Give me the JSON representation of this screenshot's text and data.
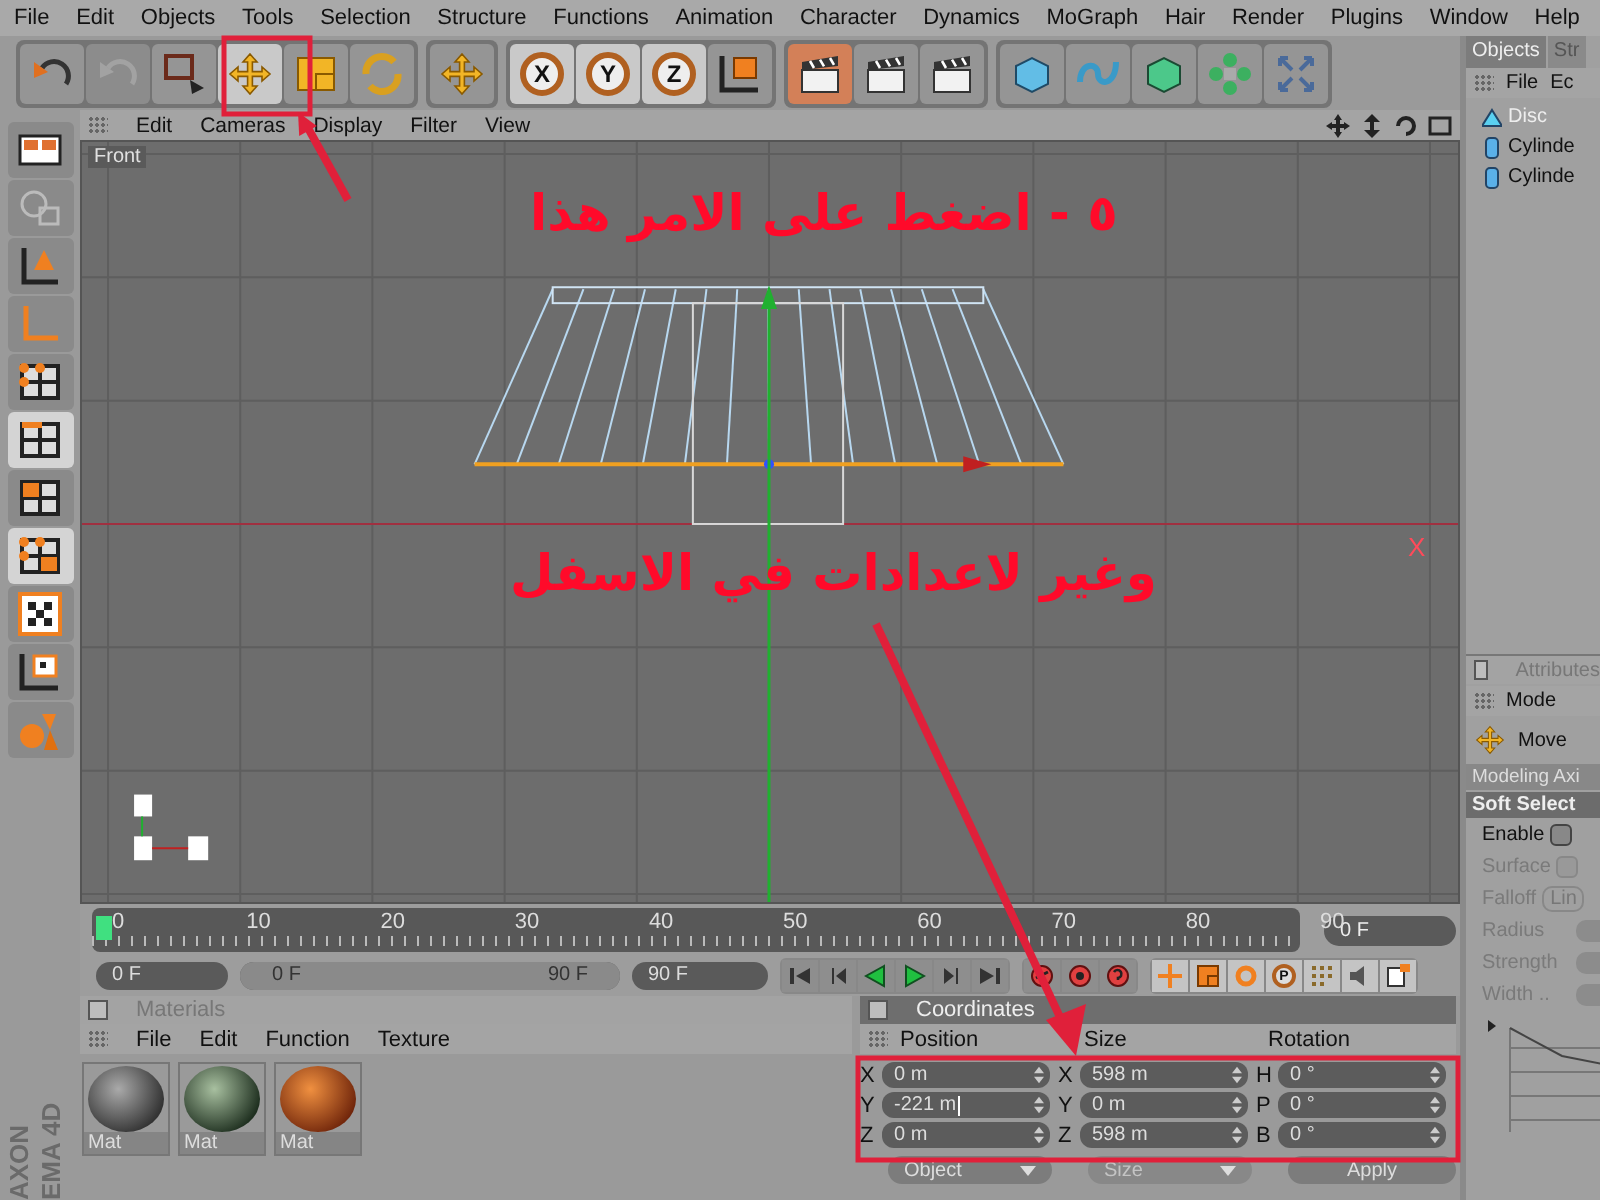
{
  "menu": [
    "File",
    "Edit",
    "Objects",
    "Tools",
    "Selection",
    "Structure",
    "Functions",
    "Animation",
    "Character",
    "Dynamics",
    "MoGraph",
    "Hair",
    "Render",
    "Plugins",
    "Window",
    "Help"
  ],
  "toolbar": {
    "groups": [
      [
        {
          "kind": "undo",
          "selected": false,
          "disabled": false
        },
        {
          "kind": "redo",
          "selected": false,
          "disabled": true
        },
        {
          "kind": "rect-select",
          "selected": false,
          "disabled": false
        },
        {
          "kind": "move",
          "selected": true,
          "disabled": false
        },
        {
          "kind": "scale",
          "selected": false,
          "disabled": false
        },
        {
          "kind": "rotate",
          "selected": false,
          "disabled": false
        }
      ],
      [
        {
          "kind": "move-menu",
          "selected": false,
          "disabled": false
        }
      ],
      [
        {
          "kind": "axis",
          "label": "X",
          "selected": true,
          "disabled": false
        },
        {
          "kind": "axis",
          "label": "Y",
          "selected": true,
          "disabled": false
        },
        {
          "kind": "axis",
          "label": "Z",
          "selected": true,
          "disabled": false
        },
        {
          "kind": "coord",
          "selected": false,
          "disabled": false
        }
      ],
      [
        {
          "kind": "render-view",
          "selected": true,
          "disabled": false
        },
        {
          "kind": "render-picture",
          "selected": false,
          "disabled": false
        },
        {
          "kind": "render-settings",
          "selected": false,
          "disabled": false
        }
      ],
      [
        {
          "kind": "cube",
          "selected": false,
          "disabled": false
        },
        {
          "kind": "spline",
          "selected": false,
          "disabled": false
        },
        {
          "kind": "nurbs",
          "selected": false,
          "disabled": false
        },
        {
          "kind": "array",
          "selected": false,
          "disabled": false
        },
        {
          "kind": "deformer",
          "selected": false,
          "disabled": false
        }
      ]
    ]
  },
  "mode_tools": [
    {
      "kind": "layout",
      "selected": false
    },
    {
      "kind": "faded",
      "selected": false
    },
    {
      "kind": "model",
      "selected": false
    },
    {
      "kind": "object-axis",
      "selected": false
    },
    {
      "kind": "points",
      "selected": false
    },
    {
      "kind": "edges",
      "selected": true
    },
    {
      "kind": "polygons",
      "selected": false
    },
    {
      "kind": "uv-polygons",
      "selected": true
    },
    {
      "kind": "texture",
      "selected": false
    },
    {
      "kind": "texture-axis",
      "selected": false
    },
    {
      "kind": "sculpt",
      "selected": false
    }
  ],
  "logo": [
    "AXON",
    "EMA 4D"
  ],
  "viewport": {
    "menu": [
      "Edit",
      "Cameras",
      "Display",
      "Filter",
      "View"
    ],
    "nav_icons": [
      {
        "kind": "move"
      },
      {
        "kind": "dolly"
      },
      {
        "kind": "rotate"
      },
      {
        "kind": "maximize"
      }
    ],
    "camera_label": "Front",
    "axis_label": "X"
  },
  "timeline": {
    "ticks": [
      "0",
      "10",
      "20",
      "30",
      "40",
      "50",
      "60",
      "70",
      "80",
      "90"
    ],
    "level": 0,
    "frame_field": "0 F"
  },
  "controls": {
    "start": "0 F",
    "range": {
      "start": "0 F",
      "end": "90 F",
      "level": 1
    },
    "end": "90 F",
    "playback": [
      {
        "kind": "first"
      },
      {
        "kind": "prev-key"
      },
      {
        "kind": "play-back"
      },
      {
        "kind": "play"
      },
      {
        "kind": "next-key"
      },
      {
        "kind": "last"
      }
    ],
    "record": [
      {
        "kind": "record"
      },
      {
        "kind": "autokey"
      },
      {
        "kind": "help"
      }
    ],
    "keys": [
      {
        "kind": "position"
      },
      {
        "kind": "scale"
      },
      {
        "kind": "rotation"
      },
      {
        "kind": "parameter",
        "label": "P"
      },
      {
        "kind": "points"
      },
      {
        "kind": "sound"
      },
      {
        "kind": "more"
      }
    ]
  },
  "materials": {
    "title": "Materials",
    "checked": false,
    "menu": [
      "File",
      "Edit",
      "Function",
      "Texture"
    ],
    "items": [
      {
        "name": "Mat",
        "kind": "noise"
      },
      {
        "name": "Mat",
        "kind": "plaid"
      },
      {
        "name": "Mat",
        "kind": "wood"
      }
    ]
  },
  "coordinates": {
    "title": "Coordinates",
    "checked": false,
    "columns": [
      {
        "header": "Position",
        "fields": [
          {
            "axis": "X",
            "value": "0 m",
            "editing": false
          },
          {
            "axis": "Y",
            "value": "-221 m",
            "editing": true
          },
          {
            "axis": "Z",
            "value": "0 m",
            "editing": false
          }
        ]
      },
      {
        "header": "Size",
        "fields": [
          {
            "axis": "X",
            "value": "598 m",
            "editing": false
          },
          {
            "axis": "Y",
            "value": "0 m",
            "editing": false
          },
          {
            "axis": "Z",
            "value": "598 m",
            "editing": false
          }
        ]
      },
      {
        "header": "Rotation",
        "fields": [
          {
            "axis": "H",
            "value": "0 °",
            "editing": false
          },
          {
            "axis": "P",
            "value": "0 °",
            "editing": false
          },
          {
            "axis": "B",
            "value": "0 °",
            "editing": false
          }
        ]
      }
    ],
    "buttons": [
      {
        "kind": "dropdown",
        "label": "Object",
        "disabled": false
      },
      {
        "kind": "dropdown",
        "label": "Size",
        "disabled": true
      },
      {
        "kind": "button",
        "label": "Apply",
        "disabled": false
      }
    ]
  },
  "objects": {
    "tabs": [
      {
        "label": "Objects",
        "selected": true
      },
      {
        "label": "Str",
        "selected": false
      }
    ],
    "menu": [
      "File",
      "Ec"
    ],
    "items": [
      {
        "name": "Disc",
        "kind": "disc",
        "selected": true
      },
      {
        "name": "Cylinde",
        "kind": "cylinder",
        "selected": false
      },
      {
        "name": "Cylinde",
        "kind": "cylinder",
        "selected": false
      }
    ]
  },
  "attributes": {
    "title": "Attributes",
    "checked": false,
    "menu": [
      "Mode"
    ],
    "tool": "Move",
    "axis_dropdown": "Modeling Axi",
    "section": "Soft Select",
    "fields": [
      {
        "kind": "checkbox",
        "label": "Enable",
        "checked": false,
        "disabled": false
      },
      {
        "kind": "checkbox",
        "label": "Surface",
        "checked": false,
        "disabled": true
      },
      {
        "kind": "dropdown",
        "label": "Falloff",
        "value": "Lin",
        "disabled": true
      },
      {
        "kind": "number",
        "label": "Radius",
        "disabled": true
      },
      {
        "kind": "number",
        "label": "Strength",
        "disabled": true
      },
      {
        "kind": "number",
        "label": "Width ..",
        "disabled": true
      }
    ]
  },
  "annotations": [
    {
      "text": "٥ - اضغط على الامر هذا"
    },
    {
      "text": "وغير لاعدادات في الاسفل"
    }
  ]
}
